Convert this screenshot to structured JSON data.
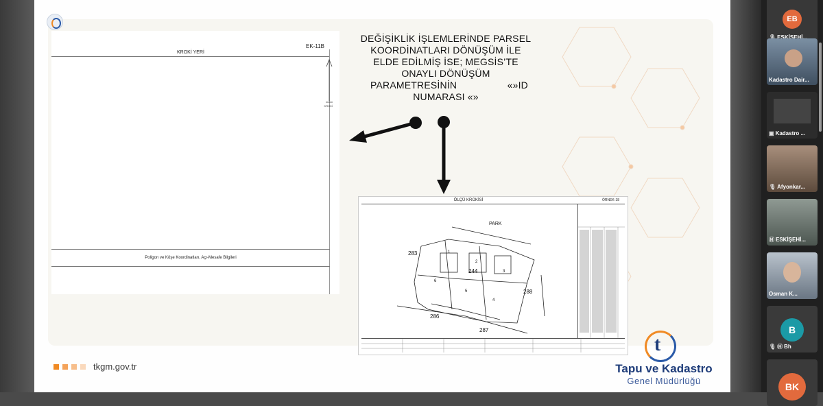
{
  "slide": {
    "form_left": {
      "code": "EK-11B",
      "title": "KROKİ YERİ",
      "north_label": "KROKİ",
      "footer_text": "Poligon ve Köşe Koordinatları, Açı-Mesafe Bilgileri"
    },
    "callout": {
      "line1": "DEĞİŞİKLİK İŞLEMLERİNDE PARSEL",
      "line2": "KOORDİNATLARI DÖNÜŞÜM İLE",
      "line3": "ELDE EDİLMİŞ İSE; MEGSİS’TE",
      "line4": "ONAYLI DÖNÜŞÜM",
      "line5a": "PARAMETRESİNİN",
      "line5b": "«»ID",
      "line6": "NUMARASI «»"
    },
    "olcu": {
      "title": "ÖLÇÜ KROKİSİ",
      "ornek": "ÖRNEK-18",
      "labels": {
        "park": "PARK",
        "p283": "283",
        "p286": "286",
        "p287": "287",
        "p288": "288",
        "p244": "244",
        "p1": "1",
        "p2": "2",
        "p3": "3",
        "p4": "4",
        "p5": "5",
        "p6": "6"
      }
    },
    "footer_url": "tkgm.gov.tr",
    "brand_line1": "Tapu ve Kadastro",
    "brand_line2": "Genel Müdürlüğü",
    "colors": {
      "accent_orange": "#f08a24",
      "brand_blue": "#1f3d7a"
    }
  },
  "participants": [
    {
      "name": "ESKİŞEHİ...",
      "initials": "EB",
      "avatar_color": "#e26a3d",
      "type": "avatar-top"
    },
    {
      "name": "Kadastro Dair...",
      "type": "video"
    },
    {
      "name": "Kadastro ...",
      "type": "screen"
    },
    {
      "name": "Afyonkar...",
      "type": "video"
    },
    {
      "name": "ESKİŞEHİ...",
      "type": "video"
    },
    {
      "name": "Osman K...",
      "type": "video"
    },
    {
      "name": "Bh",
      "initials": "B",
      "avatar_color": "#1b9aa6",
      "type": "avatar"
    },
    {
      "name": "",
      "initials": "BK",
      "avatar_color": "#e26a3d",
      "type": "avatar-partial"
    }
  ]
}
